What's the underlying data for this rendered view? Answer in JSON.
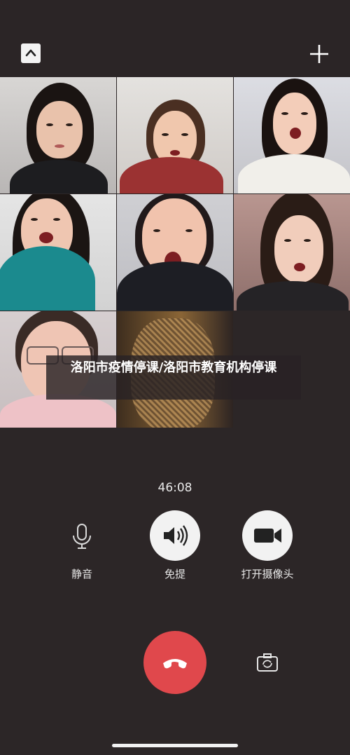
{
  "top": {
    "collapse_icon": "chevron-up-icon",
    "add_icon": "plus-icon"
  },
  "participants": [
    {
      "id": "p1"
    },
    {
      "id": "p2"
    },
    {
      "id": "p3"
    },
    {
      "id": "p4"
    },
    {
      "id": "p5"
    },
    {
      "id": "p6"
    },
    {
      "id": "p7"
    },
    {
      "id": "p8"
    }
  ],
  "banner": {
    "text": "洛阳市疫情停课/洛阳市教育机构停课"
  },
  "call": {
    "duration": "46:08",
    "mute_label": "静音",
    "speaker_label": "免提",
    "camera_label": "打开摄像头"
  },
  "icons": {
    "mute": "microphone-icon",
    "speaker": "speaker-icon",
    "camera": "video-camera-icon",
    "end": "hang-up-phone-icon",
    "flip": "flip-camera-icon"
  },
  "colors": {
    "end_call": "#e0484c",
    "background": "#2c2627",
    "control_circle": "#f2f2f2"
  }
}
